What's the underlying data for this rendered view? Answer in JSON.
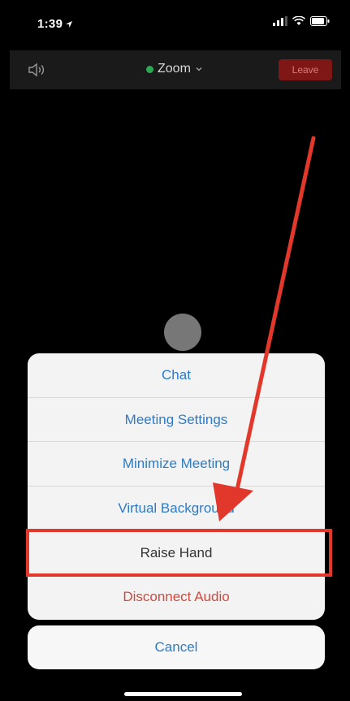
{
  "status_bar": {
    "time": "1:39"
  },
  "header": {
    "meeting_title": "Zoom",
    "leave_label": "Leave"
  },
  "action_sheet": {
    "items": [
      {
        "label": "Chat"
      },
      {
        "label": "Meeting Settings"
      },
      {
        "label": "Minimize Meeting"
      },
      {
        "label": "Virtual Background"
      },
      {
        "label": "Raise Hand"
      },
      {
        "label": "Disconnect Audio"
      }
    ],
    "cancel_label": "Cancel"
  },
  "icons": {
    "status": [
      "location-arrow-icon",
      "signal-icon",
      "wifi-icon",
      "battery-icon"
    ],
    "header": [
      "speaker-icon",
      "chevron-down-icon"
    ]
  },
  "colors": {
    "action_text": "#2d7bc6",
    "danger_text": "#d14a3f",
    "leave_button": "#7f1717",
    "annotation": "#e2382b",
    "secure_dot": "#2aa952"
  }
}
